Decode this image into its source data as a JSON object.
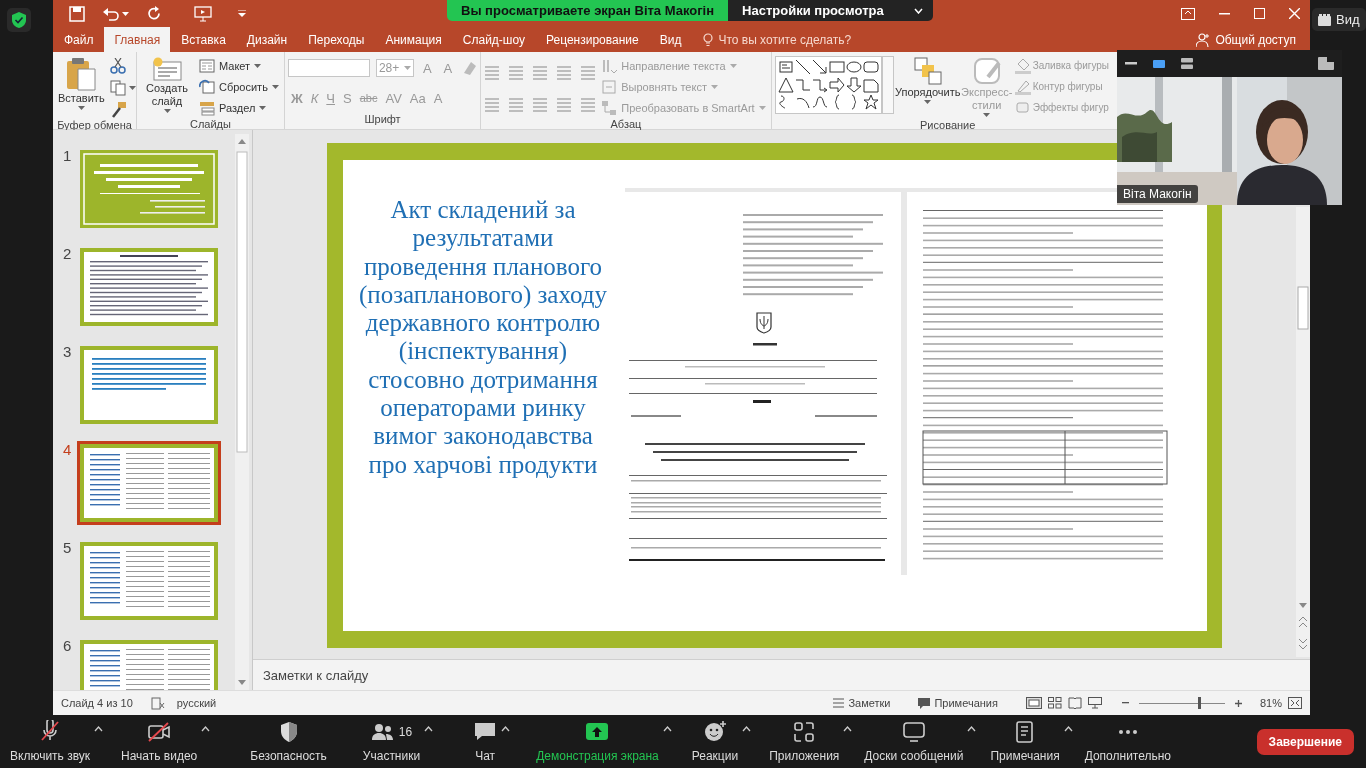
{
  "share_banner": {
    "text": "Вы просматриваете экран Віта Макогін",
    "settings": "Настройки просмотра"
  },
  "view_button": "Вид",
  "video_tile": {
    "name": "Віта Макогін"
  },
  "powerpoint": {
    "tabs": [
      {
        "label": "Файл",
        "selected": false
      },
      {
        "label": "Главная",
        "selected": true
      },
      {
        "label": "Вставка",
        "selected": false
      },
      {
        "label": "Дизайн",
        "selected": false
      },
      {
        "label": "Переходы",
        "selected": false
      },
      {
        "label": "Анимация",
        "selected": false
      },
      {
        "label": "Слайд-шоу",
        "selected": false
      },
      {
        "label": "Рецензирование",
        "selected": false
      },
      {
        "label": "Вид",
        "selected": false
      }
    ],
    "tell_me": {
      "placeholder": "Что вы хотите сделать?"
    },
    "share": "Общий доступ",
    "ribbon": {
      "groups": [
        {
          "kind": "clipboard",
          "label": "Буфер обмена",
          "buttons": [
            {
              "label": "Вставить",
              "disabled": false
            }
          ]
        },
        {
          "kind": "slides",
          "label": "Слайды",
          "buttons": [
            {
              "label": "Создать слайд",
              "disabled": false
            }
          ],
          "commands": [
            {
              "label": "Макет",
              "disabled": false
            },
            {
              "label": "Сбросить",
              "disabled": false
            },
            {
              "label": "Раздел",
              "disabled": false
            }
          ]
        },
        {
          "kind": "font",
          "label": "Шрифт",
          "size": "28+",
          "size_buttons": [
            "A",
            "A"
          ],
          "format_buttons": [
            "Ж",
            "К",
            "Ч",
            "S",
            "abc",
            "AV",
            "Aa",
            "A"
          ]
        },
        {
          "kind": "paragraph",
          "label": "Абзац",
          "commands": [
            {
              "label": "Направление текста",
              "disabled": true
            },
            {
              "label": "Выровнять текст",
              "disabled": true
            },
            {
              "label": "Преобразовать в SmartArt",
              "disabled": true
            }
          ]
        },
        {
          "kind": "drawing",
          "label": "Рисование",
          "buttons": [
            {
              "label": "Упорядочить",
              "disabled": false
            },
            {
              "label": "Экспресс-стили",
              "disabled": true
            }
          ],
          "commands": [
            {
              "label": "Заливка фигуры",
              "disabled": true
            },
            {
              "label": "Контур фигуры",
              "disabled": true
            },
            {
              "label": "Эффекты фигур",
              "disabled": true
            }
          ]
        }
      ]
    },
    "thumbnails": [
      {
        "number": "1",
        "kind": "title",
        "selected": false
      },
      {
        "number": "2",
        "kind": "text",
        "selected": false
      },
      {
        "number": "3",
        "kind": "blue",
        "selected": false
      },
      {
        "number": "4",
        "kind": "document",
        "selected": true
      },
      {
        "number": "5",
        "kind": "document",
        "selected": false
      },
      {
        "number": "6",
        "kind": "document",
        "selected": false
      }
    ],
    "slide": {
      "title": "Акт складений за результатами проведення планового (позапланового) заходу державного контролю (інспектування) стосовно дотримання операторами ринку вимог законодавства про харчові продукти"
    },
    "notes": {
      "placeholder": "Заметки к слайду"
    },
    "status_bar": {
      "slide": "Слайд 4 из 10",
      "language": "русский",
      "notes": "Заметки",
      "comments": "Примечания",
      "zoom": "81%",
      "zoom_slider": {
        "level": 0.7
      }
    }
  },
  "meeting_toolbar": {
    "items": [
      {
        "label": "Включить звук",
        "active": false
      },
      {
        "label": "Начать видео",
        "active": false
      },
      {
        "label": "Безопасность",
        "active": false
      },
      {
        "label": "Участники",
        "count": "16",
        "active": false
      },
      {
        "label": "Чат",
        "active": false
      },
      {
        "label": "Демонстрация экрана",
        "active": true
      },
      {
        "label": "Реакции",
        "active": false
      },
      {
        "label": "Приложения",
        "active": false
      },
      {
        "label": "Доски сообщений",
        "active": false
      },
      {
        "label": "Примечания",
        "active": false
      },
      {
        "label": "Дополнительно",
        "active": false
      }
    ],
    "end": "Завершение"
  }
}
